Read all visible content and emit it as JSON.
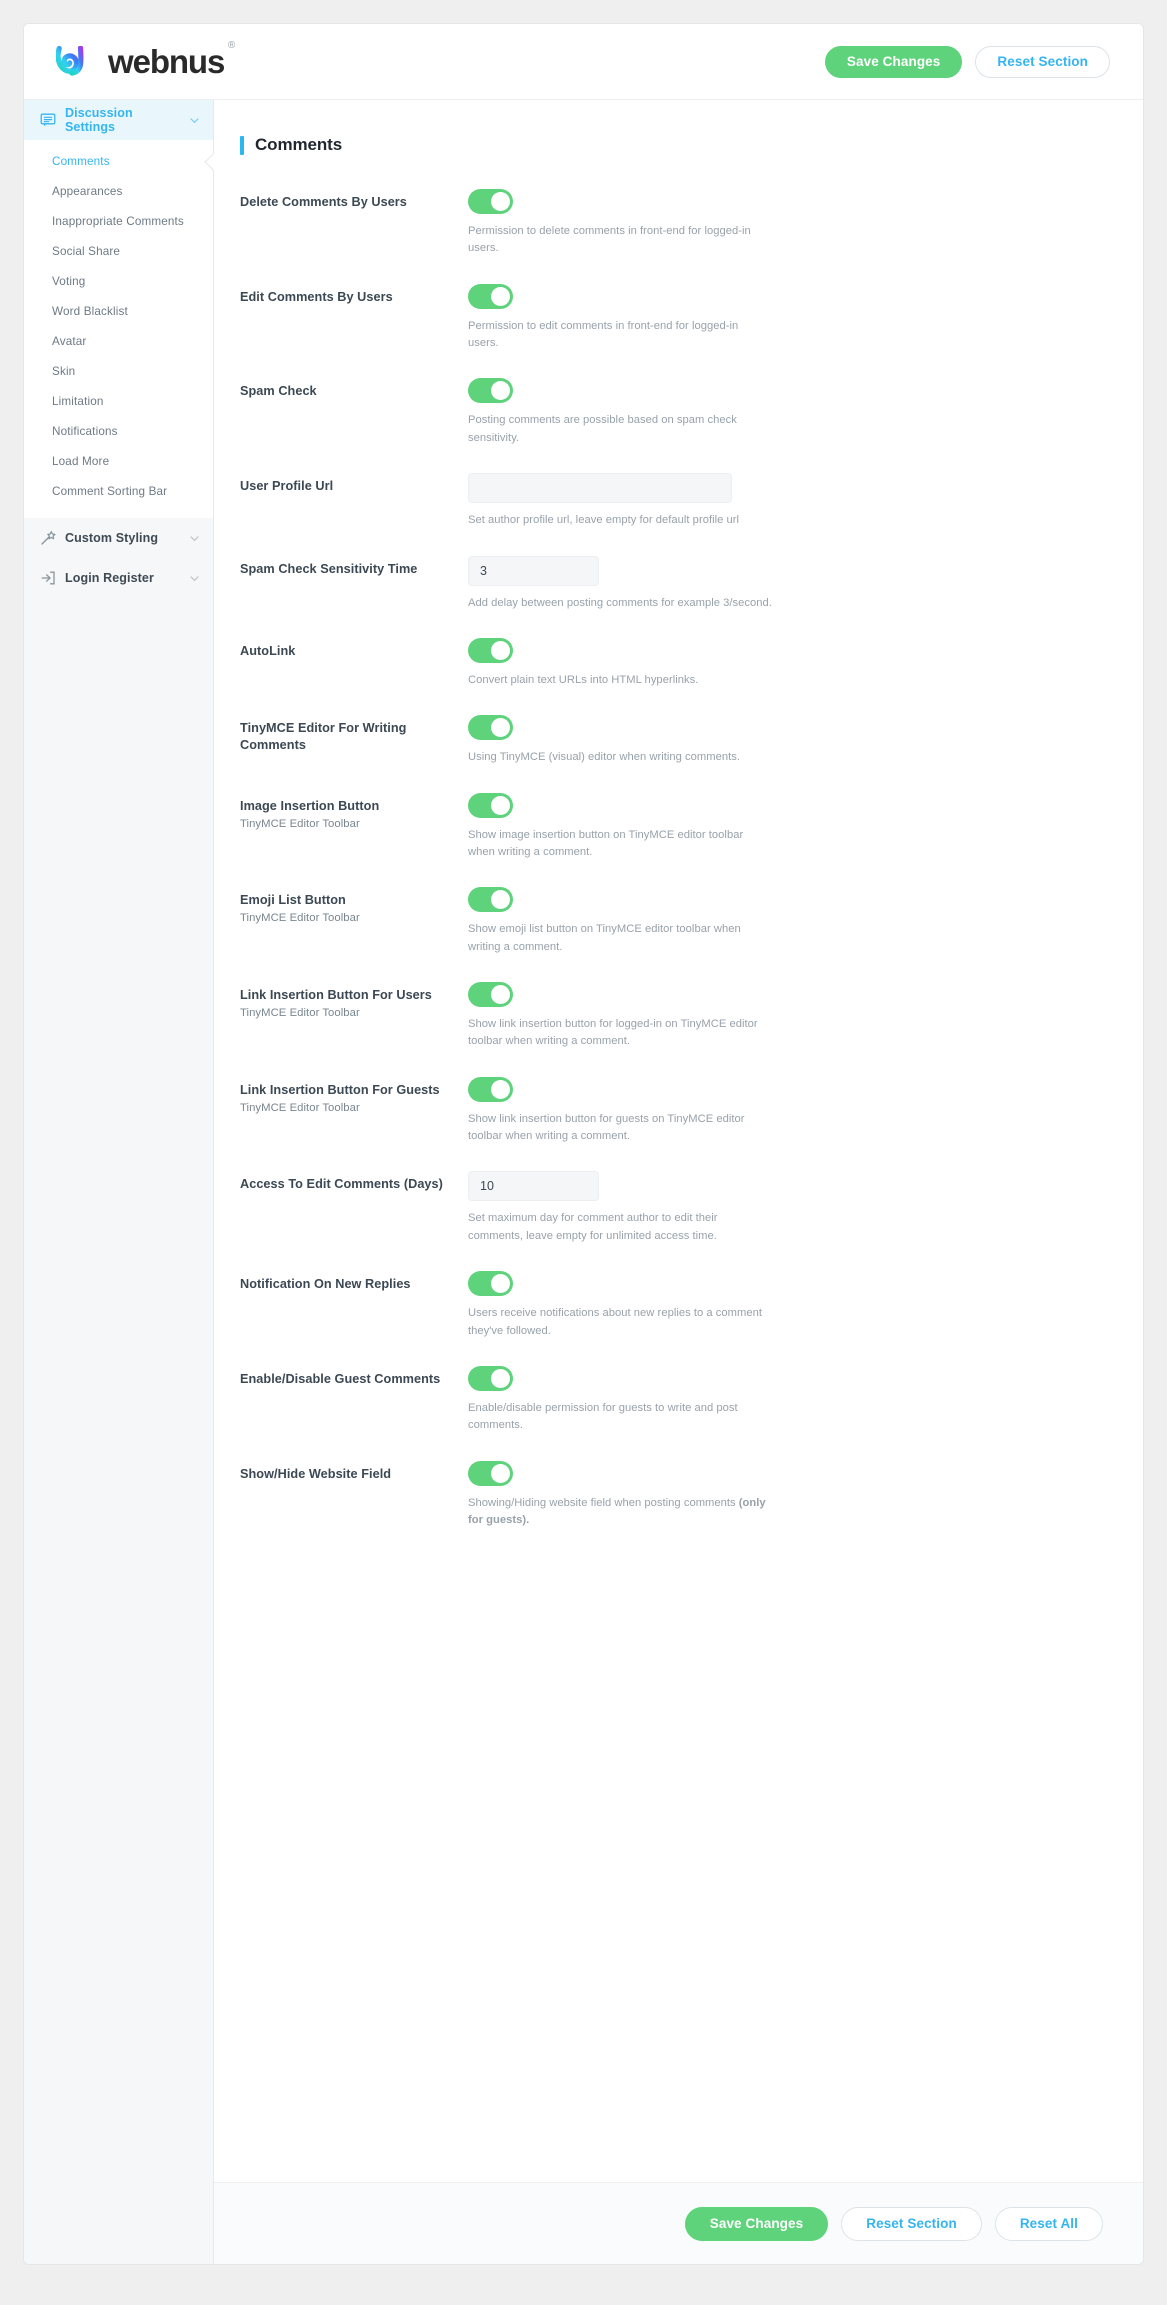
{
  "brand": {
    "name": "webnus",
    "registered_mark": "®",
    "logo_icon": "webnus-logo-icon"
  },
  "topbar": {
    "save_label": "Save Changes",
    "reset_section_label": "Reset Section"
  },
  "sidebar": {
    "groups": [
      {
        "label": "Discussion Settings",
        "icon": "comment-bubble-icon",
        "active": true,
        "expanded": true,
        "chevron": "chevron-down-icon",
        "items": [
          {
            "label": "Comments",
            "current": true
          },
          {
            "label": "Appearances",
            "current": false
          },
          {
            "label": "Inappropriate Comments",
            "current": false
          },
          {
            "label": "Social Share",
            "current": false
          },
          {
            "label": "Voting",
            "current": false
          },
          {
            "label": "Word Blacklist",
            "current": false
          },
          {
            "label": "Avatar",
            "current": false
          },
          {
            "label": "Skin",
            "current": false
          },
          {
            "label": "Limitation",
            "current": false
          },
          {
            "label": "Notifications",
            "current": false
          },
          {
            "label": "Load More",
            "current": false
          },
          {
            "label": "Comment Sorting Bar",
            "current": false
          }
        ]
      },
      {
        "label": "Custom Styling",
        "icon": "magic-wand-icon",
        "active": false,
        "expanded": false,
        "chevron": "chevron-down-icon",
        "items": []
      },
      {
        "label": "Login Register",
        "icon": "login-arrow-icon",
        "active": false,
        "expanded": false,
        "chevron": "chevron-down-icon",
        "items": []
      }
    ]
  },
  "main": {
    "section_title": "Comments",
    "fields": [
      {
        "label": "Delete Comments By Users",
        "sublabel": "",
        "control": "toggle",
        "value": "on",
        "hint": "Permission to delete comments in front-end for logged-in users.",
        "hint_bold": ""
      },
      {
        "label": "Edit Comments By Users",
        "sublabel": "",
        "control": "toggle",
        "value": "on",
        "hint": "Permission to edit comments in front-end for logged-in users.",
        "hint_bold": ""
      },
      {
        "label": "Spam Check",
        "sublabel": "",
        "control": "toggle",
        "value": "on",
        "hint": "Posting comments are possible based on spam check sensitivity.",
        "hint_bold": ""
      },
      {
        "label": "User Profile Url",
        "sublabel": "",
        "control": "text-wide",
        "value": "",
        "placeholder": "",
        "hint": "Set author profile url, leave empty for default profile url",
        "hint_bold": ""
      },
      {
        "label": "Spam Check Sensitivity Time",
        "sublabel": "",
        "control": "text-narrow",
        "value": "3",
        "placeholder": "",
        "hint": "Add delay between posting comments for example 3/second.",
        "hint_bold": ""
      },
      {
        "label": "AutoLink",
        "sublabel": "",
        "control": "toggle",
        "value": "on",
        "hint": "Convert plain text URLs into HTML hyperlinks.",
        "hint_bold": ""
      },
      {
        "label": "TinyMCE Editor For Writing Comments",
        "sublabel": "",
        "control": "toggle",
        "value": "on",
        "hint": "Using TinyMCE (visual) editor when writing comments.",
        "hint_bold": ""
      },
      {
        "label": "Image Insertion Button",
        "sublabel": "TinyMCE Editor Toolbar",
        "control": "toggle",
        "value": "on",
        "hint": "Show image insertion button on TinyMCE editor toolbar when writing a comment.",
        "hint_bold": ""
      },
      {
        "label": "Emoji List Button",
        "sublabel": "TinyMCE Editor Toolbar",
        "control": "toggle",
        "value": "on",
        "hint": "Show emoji list button on TinyMCE editor toolbar when writing a comment.",
        "hint_bold": ""
      },
      {
        "label": "Link Insertion Button For Users",
        "sublabel": "TinyMCE Editor Toolbar",
        "control": "toggle",
        "value": "on",
        "hint": "Show link insertion button for logged-in on TinyMCE editor toolbar when writing a comment.",
        "hint_bold": ""
      },
      {
        "label": "Link Insertion Button For Guests",
        "sublabel": "TinyMCE Editor Toolbar",
        "control": "toggle",
        "value": "on",
        "hint": "Show link insertion button for guests on TinyMCE editor toolbar when writing a comment.",
        "hint_bold": ""
      },
      {
        "label": "Access To Edit Comments (Days)",
        "sublabel": "",
        "control": "text-narrow",
        "value": "10",
        "placeholder": "",
        "hint": "Set maximum day for comment author to edit their comments, leave empty for unlimited access time.",
        "hint_bold": ""
      },
      {
        "label": "Notification On New Replies",
        "sublabel": "",
        "control": "toggle",
        "value": "on",
        "hint": "Users receive notifications about new replies to a comment they've followed.",
        "hint_bold": ""
      },
      {
        "label": "Enable/Disable Guest Comments",
        "sublabel": "",
        "control": "toggle",
        "value": "on",
        "hint": "Enable/disable permission for guests to write and post comments.",
        "hint_bold": ""
      },
      {
        "label": "Show/Hide Website Field",
        "sublabel": "",
        "control": "toggle",
        "value": "on",
        "hint": "Showing/Hiding website field when posting comments ",
        "hint_bold": "(only for guests)."
      }
    ]
  },
  "footer": {
    "save_label": "Save Changes",
    "reset_section_label": "Reset Section",
    "reset_all_label": "Reset All"
  },
  "colors": {
    "accent_blue": "#35B5F0",
    "toggle_green": "#5ED37B",
    "title_bar_blue": "#2BB8F0",
    "page_bg": "#EFEFEF",
    "sidebar_bg": "#F5F7F9"
  }
}
